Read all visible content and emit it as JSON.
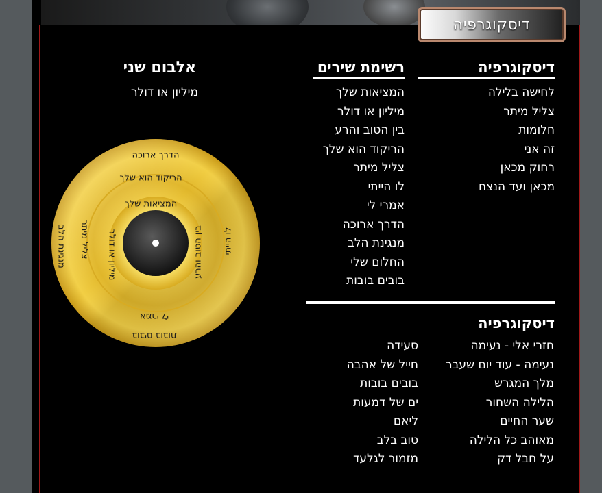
{
  "header": {
    "tab_label": "דיסקוגרפיה"
  },
  "discography_top": {
    "heading": "דיסקוגרפיה",
    "items": [
      "לחישה בלילה",
      "צליל מיתר",
      "חלומות",
      "זה אני",
      "רחוק מכאן",
      "מכאן ועד הנצח"
    ]
  },
  "song_list": {
    "heading": "רשימת שירים",
    "items": [
      "המציאות שלך",
      "מיליון או דולר",
      "בין הטוב והרע",
      "הריקוד הוא שלך",
      "צליל מיתר",
      "לו הייתי",
      "אמרי לי",
      "הדרך ארוכה",
      "מנגינת הלב",
      "החלום שלי",
      "בובים בובות"
    ]
  },
  "album": {
    "heading": "אלבום שני",
    "subtitle": "מיליון או דולר",
    "record_labels": [
      "הדרך ארוכה",
      "הריקוד הוא שלך",
      "המציאות שלך",
      "מנגינת הלב",
      "צליל מיתר",
      "מיליון או דולר",
      "בין הטוב והרע",
      "לו הייתי",
      "אמרי לי",
      "בובים בובות"
    ]
  },
  "discography_bottom": {
    "heading": "דיסקוגרפיה",
    "col_right": [
      "חזרי אלי - נעימה",
      "נעימה - עוד יום שעבר",
      "מלך המגרש",
      "הלילה השחור",
      "שער החיים",
      "מאוהב כל הלילה",
      "על חבל דק"
    ],
    "col_left": [
      "סעידה",
      "חייל של אהבה",
      "בובים בובות",
      "ים של דמעות",
      "ליאם",
      "טוב בלב",
      "מזמור לגלעד"
    ]
  },
  "colors": {
    "page_bg": "#000000",
    "side_bg": "#555a5d",
    "accent_red": "#a01818",
    "gold": "#e3b92a"
  }
}
